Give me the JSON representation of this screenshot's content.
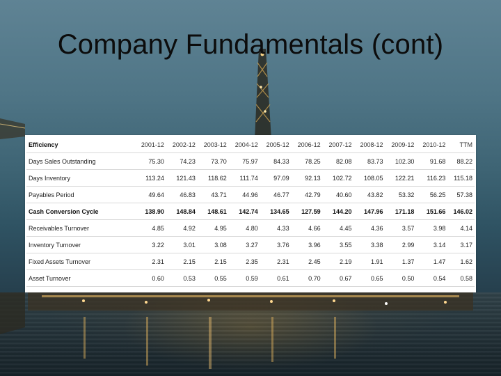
{
  "slide": {
    "title": "Company Fundamentals (cont)"
  },
  "table": {
    "header_label": "Efficiency",
    "columns": [
      "2001-12",
      "2002-12",
      "2003-12",
      "2004-12",
      "2005-12",
      "2006-12",
      "2007-12",
      "2008-12",
      "2009-12",
      "2010-12",
      "TTM"
    ],
    "rows": [
      {
        "label": "Days Sales Outstanding",
        "bold": false,
        "values": [
          "75.30",
          "74.23",
          "73.70",
          "75.97",
          "84.33",
          "78.25",
          "82.08",
          "83.73",
          "102.30",
          "91.68",
          "88.22"
        ]
      },
      {
        "label": "Days Inventory",
        "bold": false,
        "values": [
          "113.24",
          "121.43",
          "118.62",
          "111.74",
          "97.09",
          "92.13",
          "102.72",
          "108.05",
          "122.21",
          "116.23",
          "115.18"
        ]
      },
      {
        "label": "Payables Period",
        "bold": false,
        "values": [
          "49.64",
          "46.83",
          "43.71",
          "44.96",
          "46.77",
          "42.79",
          "40.60",
          "43.82",
          "53.32",
          "56.25",
          "57.38"
        ]
      },
      {
        "label": "Cash Conversion Cycle",
        "bold": true,
        "values": [
          "138.90",
          "148.84",
          "148.61",
          "142.74",
          "134.65",
          "127.59",
          "144.20",
          "147.96",
          "171.18",
          "151.66",
          "146.02"
        ]
      },
      {
        "label": "Receivables Turnover",
        "bold": false,
        "values": [
          "4.85",
          "4.92",
          "4.95",
          "4.80",
          "4.33",
          "4.66",
          "4.45",
          "4.36",
          "3.57",
          "3.98",
          "4.14"
        ]
      },
      {
        "label": "Inventory Turnover",
        "bold": false,
        "values": [
          "3.22",
          "3.01",
          "3.08",
          "3.27",
          "3.76",
          "3.96",
          "3.55",
          "3.38",
          "2.99",
          "3.14",
          "3.17"
        ]
      },
      {
        "label": "Fixed Assets Turnover",
        "bold": false,
        "values": [
          "2.31",
          "2.15",
          "2.15",
          "2.35",
          "2.31",
          "2.45",
          "2.19",
          "1.91",
          "1.37",
          "1.47",
          "1.62"
        ]
      },
      {
        "label": "Asset Turnover",
        "bold": false,
        "values": [
          "0.60",
          "0.53",
          "0.55",
          "0.59",
          "0.61",
          "0.70",
          "0.67",
          "0.65",
          "0.50",
          "0.54",
          "0.58"
        ]
      }
    ]
  }
}
